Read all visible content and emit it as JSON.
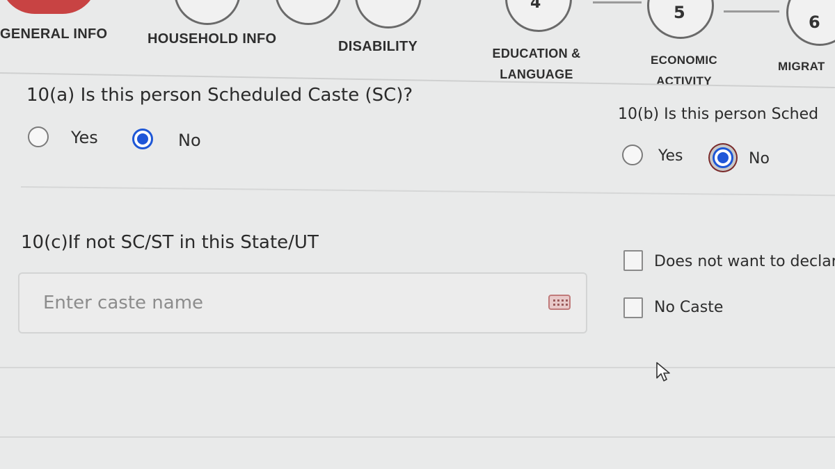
{
  "stepper": {
    "steps": [
      {
        "number": ""
      },
      {
        "number": ""
      },
      {
        "number": ""
      },
      {
        "number": "4"
      },
      {
        "number": "5"
      },
      {
        "number": "6"
      }
    ]
  },
  "tabs": {
    "general_info": "GENERAL INFO",
    "household_info": "HOUSEHOLD INFO",
    "disability": "DISABILITY",
    "education_line1": "EDUCATION &",
    "education_line2": "LANGUAGE",
    "economic_line1": "ECONOMIC",
    "economic_line2": "ACTIVITY",
    "migration": "MIGRAT"
  },
  "q10a": {
    "label": "10(a) Is this person Scheduled Caste (SC)?",
    "yes_label": "Yes",
    "no_label": "No",
    "selected": "No"
  },
  "q10b": {
    "label": "10(b) Is this person Sched",
    "yes_label": "Yes",
    "no_label": "No",
    "selected": "No"
  },
  "q10c": {
    "label": "10(c)If not SC/ST in this State/UT",
    "placeholder": "Enter caste name",
    "value": ""
  },
  "caste_options": {
    "does_not_want": "Does not want to declar",
    "no_caste": "No Caste"
  },
  "colors": {
    "accent": "#1f56d8",
    "background": "#e9eaea"
  }
}
